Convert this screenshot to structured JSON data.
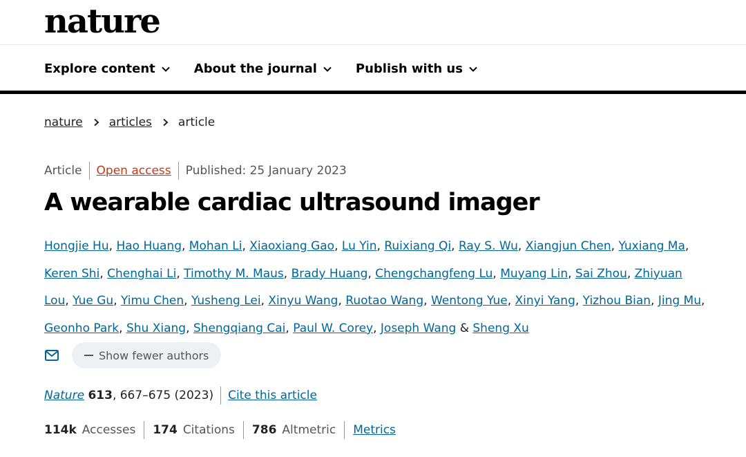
{
  "brand": {
    "logo": "nature"
  },
  "nav": {
    "items": [
      {
        "label": "Explore content"
      },
      {
        "label": "About the journal"
      },
      {
        "label": "Publish with us"
      }
    ]
  },
  "breadcrumb": {
    "items": [
      {
        "label": "nature"
      },
      {
        "label": "articles"
      },
      {
        "label": "article"
      }
    ]
  },
  "article": {
    "type": "Article",
    "access": "Open access",
    "published": "Published: 25 January 2023",
    "title": "A wearable cardiac ultrasound imager"
  },
  "authors": [
    "Hongjie Hu",
    "Hao Huang",
    "Mohan Li",
    "Xiaoxiang Gao",
    "Lu Yin",
    "Ruixiang Qi",
    "Ray S. Wu",
    "Xiangjun Chen",
    "Yuxiang Ma",
    "Keren Shi",
    "Chenghai Li",
    "Timothy M. Maus",
    "Brady Huang",
    "Chengchangfeng Lu",
    "Muyang Lin",
    "Sai Zhou",
    "Zhiyuan Lou",
    "Yue Gu",
    "Yimu Chen",
    "Yusheng Lei",
    "Xinyu Wang",
    "Ruotao Wang",
    "Wentong Yue",
    "Xinyi Yang",
    "Yizhou Bian",
    "Jing Mu",
    "Geonho Park",
    "Shu Xiang",
    "Shengqiang Cai",
    "Paul W. Corey",
    "Joseph Wang",
    "Sheng Xu"
  ],
  "author_actions": {
    "mail_icon": "envelope-icon",
    "show_fewer_label": "Show fewer authors"
  },
  "citation": {
    "journal": "Nature",
    "volume": "613",
    "pages_year": ", 667–675 (2023)",
    "cite_label": "Cite this article"
  },
  "metrics": {
    "accesses_value": "114k",
    "accesses_label": "Accesses",
    "citations_value": "174",
    "citations_label": "Citations",
    "altmetric_value": "786",
    "altmetric_label": "Altmetric",
    "metrics_link": "Metrics"
  },
  "colors": {
    "link": "#006699",
    "open_access": "#c0391b",
    "text": "#222222",
    "muted": "#555555",
    "button_bg": "#eef1f3"
  }
}
